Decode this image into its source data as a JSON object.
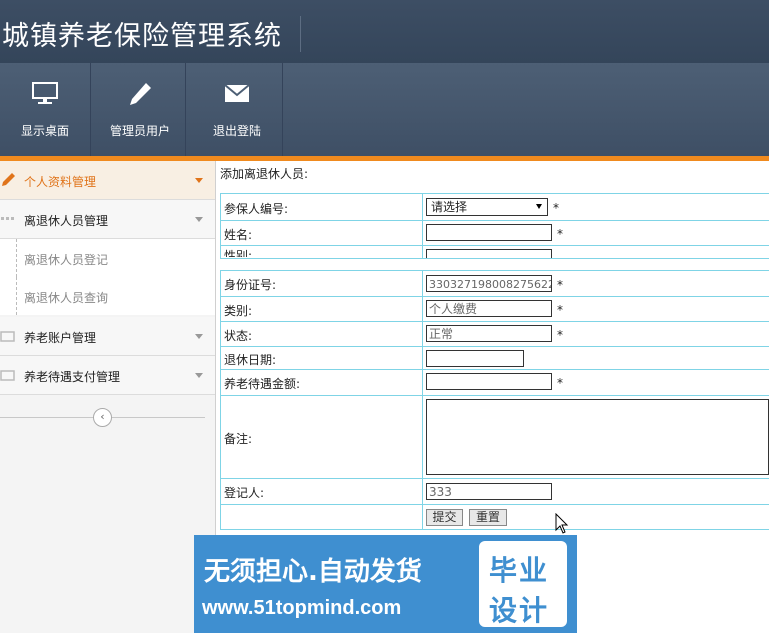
{
  "app": {
    "title": "城镇养老保险管理系统"
  },
  "toolbar": {
    "items": [
      {
        "label": "显示桌面",
        "icon": "monitor-icon"
      },
      {
        "label": "管理员用户",
        "icon": "pencil-icon"
      },
      {
        "label": "退出登陆",
        "icon": "envelope-icon"
      }
    ]
  },
  "sidebar": {
    "groups": [
      {
        "label": "个人资料管理",
        "icon": "pencil-icon",
        "active": true
      },
      {
        "label": "离退休人员管理",
        "icon": "list-icon"
      },
      {
        "label": "养老账户管理",
        "icon": "folder-icon"
      },
      {
        "label": "养老待遇支付管理",
        "icon": "folder-icon"
      }
    ],
    "subitems": [
      {
        "label": "离退休人员登记"
      },
      {
        "label": "离退休人员查询"
      }
    ],
    "collapse_icon": "chevron-left-icon"
  },
  "form": {
    "title": "添加离退休人员:",
    "required_mark": "*",
    "fields": {
      "member_id": {
        "label": "参保人编号:",
        "value": "请选择"
      },
      "name": {
        "label": "姓名:",
        "value": ""
      },
      "gender": {
        "label": "性别:"
      },
      "id_number": {
        "label": "身份证号:",
        "value": "330327198008275622"
      },
      "category": {
        "label": "类别:",
        "value": "个人缴费"
      },
      "status": {
        "label": "状态:",
        "value": "正常"
      },
      "retire_date": {
        "label": "退休日期:",
        "value": ""
      },
      "pension_amount": {
        "label": "养老待遇金额:",
        "value": ""
      },
      "remark": {
        "label": "备注:",
        "value": ""
      },
      "registrar": {
        "label": "登记人:",
        "value": "333"
      }
    },
    "submit_label": "提交",
    "reset_label": "重置"
  },
  "banner": {
    "line1": "无须担心.自动发货",
    "line2": "www.51topmind.com",
    "box_line1": "毕业",
    "box_line2": "设计"
  },
  "colors": {
    "header": "#3d4e64",
    "toolbar": "#4d5f75",
    "accent": "#f08a1e",
    "table_border": "#7fd4e6",
    "banner": "#3f8fd0"
  }
}
